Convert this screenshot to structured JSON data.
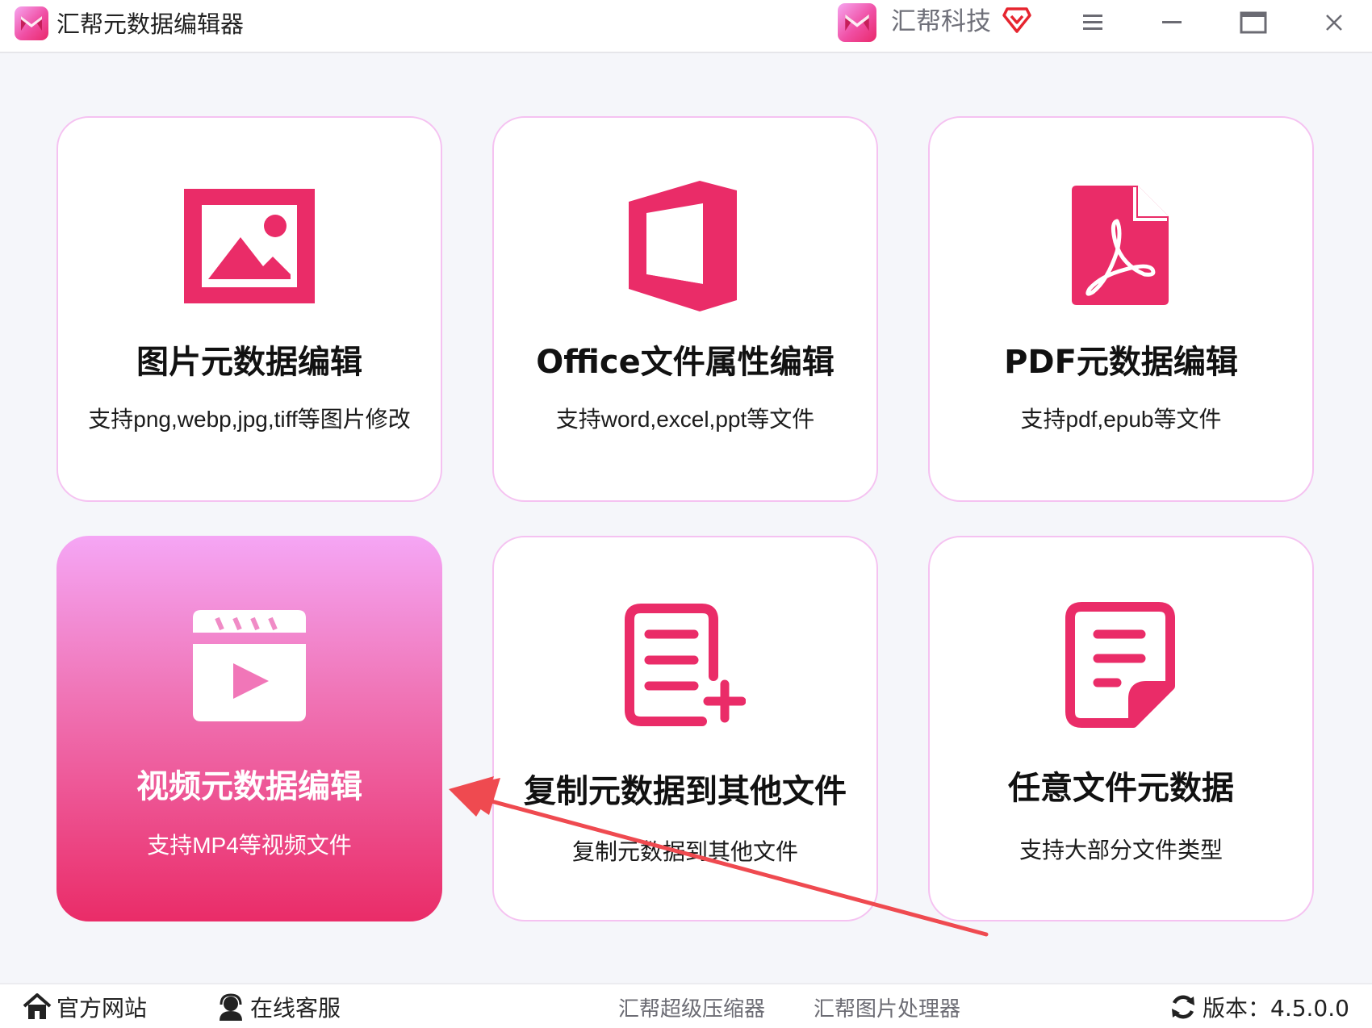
{
  "window": {
    "title": "汇帮元数据编辑器",
    "brand": "汇帮科技",
    "icons": [
      "app-logo-icon",
      "vip-diamond-icon",
      "menu-icon",
      "minimize-icon",
      "maximize-icon",
      "close-icon"
    ]
  },
  "cards": [
    {
      "title": "图片元数据编辑",
      "subtitle": "支持png,webp,jpg,tiff等图片修改",
      "icon": "image-icon"
    },
    {
      "title": "Office文件属性编辑",
      "subtitle": "支持word,excel,ppt等文件",
      "icon": "office-icon"
    },
    {
      "title": "PDF元数据编辑",
      "subtitle": "支持pdf,epub等文件",
      "icon": "pdf-icon"
    },
    {
      "title": "视频元数据编辑",
      "subtitle": "支持MP4等视频文件",
      "icon": "video-icon",
      "selected": true
    },
    {
      "title": "复制元数据到其他文件",
      "subtitle": "复制元数据到其他文件",
      "icon": "document-add-icon"
    },
    {
      "title": "任意文件元数据",
      "subtitle": "支持大部分文件类型",
      "icon": "document-icon"
    }
  ],
  "footer": {
    "website": "官方网站",
    "support": "在线客服",
    "compressor": "汇帮超级压缩器",
    "image_tool": "汇帮图片处理器",
    "version": "版本：4.5.0.0"
  },
  "colors": {
    "accent": "#ea2c68",
    "card_border": "#f5c2f1",
    "annotation_arrow": "#ef4a50"
  }
}
